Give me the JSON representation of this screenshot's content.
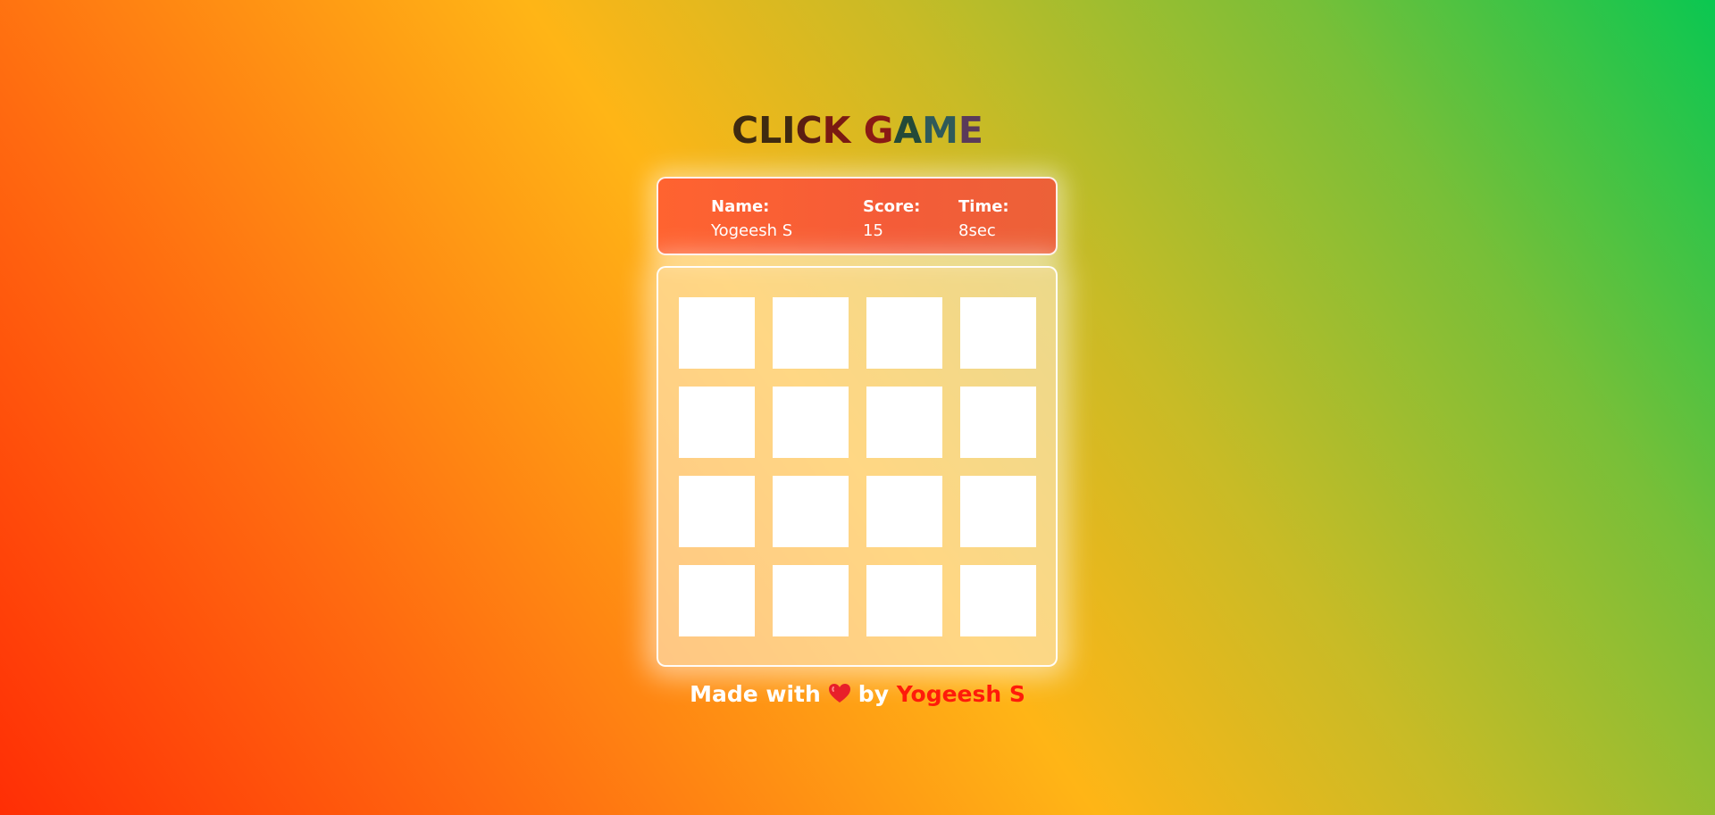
{
  "title": {
    "text": "CLICK GAME",
    "letters": [
      "C",
      "L",
      "I",
      "C",
      "K",
      " ",
      "G",
      "A",
      "M",
      "E"
    ],
    "letter_colors": [
      "#3f2a10",
      "#3f2a10",
      "#3f2a10",
      "#5a1e12",
      "#7a1a12",
      "#7a1a12",
      "#8a1a14",
      "#244a38",
      "#2f5a5a",
      "#5a3a5a"
    ]
  },
  "info": {
    "name_label": "Name:",
    "name_value": "Yogeesh S",
    "score_label": "Score:",
    "score_value": "15",
    "time_label": "Time:",
    "time_value": "8sec"
  },
  "board": {
    "rows": 4,
    "cols": 4,
    "cells": 16
  },
  "footer": {
    "made_with": "Made with",
    "heart_icon": "heart-icon",
    "by": "by",
    "author": "Yogeesh S"
  },
  "colors": {
    "info_card": "#f45c38",
    "author": "#ff1a0a",
    "heart": "#e8202a",
    "cell": "#ffffff"
  }
}
